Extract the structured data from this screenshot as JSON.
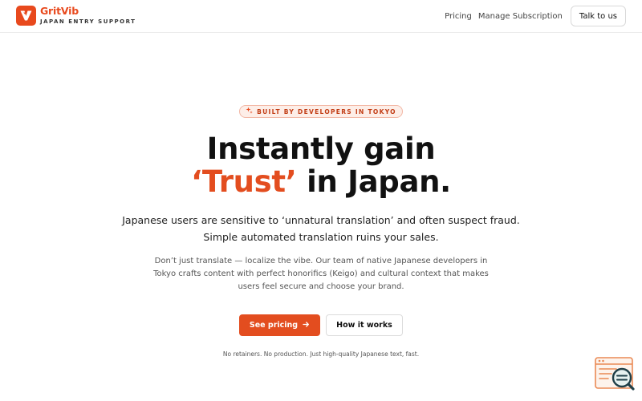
{
  "brand": {
    "name": "GritVib",
    "tagline": "JAPAN ENTRY SUPPORT"
  },
  "nav": {
    "pricing": "Pricing",
    "manage_subscription": "Manage Subscription",
    "talk_to_us": "Talk to us"
  },
  "hero": {
    "badge": "BUILT BY DEVELOPERS IN TOKYO",
    "headline_line1": "Instantly gain",
    "headline_accent": "‘Trust’",
    "headline_rest": " in Japan.",
    "lead": "Japanese users are sensitive to ‘unnatural translation’ and often suspect fraud. Simple automated translation ruins your sales.",
    "body": "Don’t just translate — localize the vibe. Our team of native Japanese developers in Tokyo crafts content with perfect honorifics (Keigo) and cultural context that makes users feel secure and choose your brand.",
    "cta_primary": "See pricing",
    "cta_secondary": "How it works",
    "footnote": "No retainers. No production. Just high-quality Japanese text, fast."
  },
  "colors": {
    "accent": "#e34d1f",
    "badge_bg": "#fdeee8",
    "badge_text": "#c23d15"
  },
  "icons": {
    "logo": "v-logo-icon",
    "badge": "sparkle-icon",
    "cta_arrow": "arrow-right-icon",
    "widget": "browser-search-icon"
  }
}
